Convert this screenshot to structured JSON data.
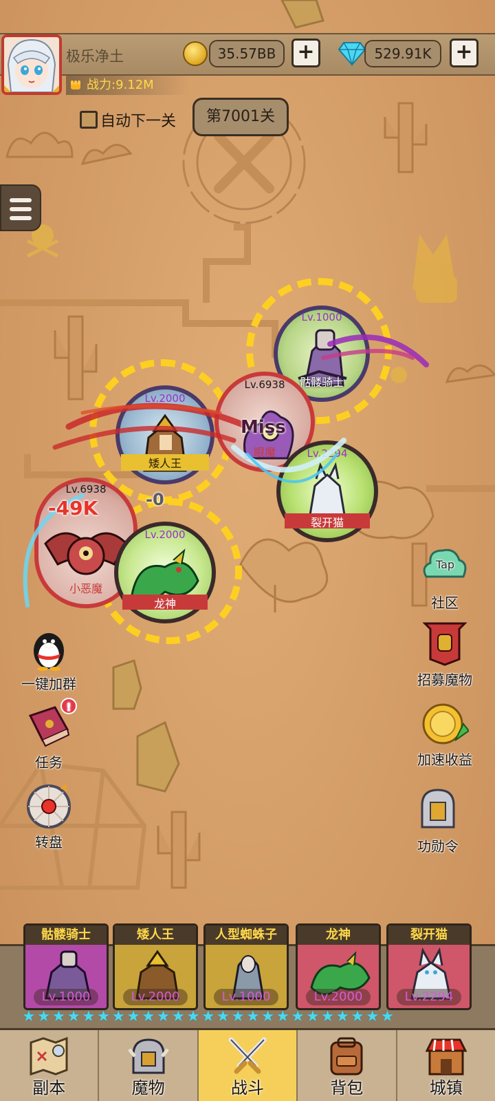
{
  "player": {
    "name": "极乐净土",
    "power": "战力:9.12M"
  },
  "currency": {
    "gold": "35.57BB",
    "gems": "529.91K",
    "plus": "+"
  },
  "stage": {
    "auto_next_label": "自动下一关",
    "level_label": "第7001关"
  },
  "battle_units": [
    {
      "lv": "Lv.1000",
      "name": "骷髅骑士",
      "lv_color": "#9b30c9"
    },
    {
      "lv": "Lv.2000",
      "name": "矮人王",
      "lv_color": "#9b30c9"
    },
    {
      "lv": "Lv.6938",
      "name": "眼魔",
      "lv_color": "#1a1a1a"
    },
    {
      "lv": "Lv.2294",
      "name": "裂开猫",
      "lv_color": "#9b30c9"
    },
    {
      "lv": "Lv.6938",
      "name": "小恶魔",
      "lv_color": "#1a1a1a"
    },
    {
      "lv": "Lv.2000",
      "name": "龙神",
      "lv_color": "#9b30c9"
    }
  ],
  "floating_text": {
    "miss": "Miss",
    "damage": "-49K",
    "zero": "-0"
  },
  "side_buttons": {
    "community": "社区",
    "community_tag": "Tap",
    "recruit": "招募魔物",
    "boost": "加速收益",
    "merit": "功勋令",
    "join_group": "一键加群",
    "tasks": "任务",
    "tasks_badge": "!",
    "wheel": "转盘"
  },
  "roster": [
    {
      "name": "骷髅骑士",
      "lv": "Lv.1000",
      "bg": "#b34aa8"
    },
    {
      "name": "矮人王",
      "lv": "Lv.2000",
      "bg": "#c8a43a"
    },
    {
      "name": "人型蜘蛛子",
      "lv": "Lv.1000",
      "bg": "#c8a43a"
    },
    {
      "name": "龙神",
      "lv": "Lv.2000",
      "bg": "#d0566a"
    },
    {
      "name": "裂开猫",
      "lv": "Lv.2294",
      "bg": "#d0566a"
    }
  ],
  "nav": [
    {
      "label": "副本",
      "icon": "map-icon"
    },
    {
      "label": "魔物",
      "icon": "helmet-icon"
    },
    {
      "label": "战斗",
      "icon": "crossed-swords-icon",
      "active": true
    },
    {
      "label": "背包",
      "icon": "backpack-icon"
    },
    {
      "label": "城镇",
      "icon": "shop-icon"
    }
  ],
  "colors": {
    "accent_yellow": "#ffd21e",
    "gem_cyan": "#4ad8f0",
    "nav_active": "#f5cf5a"
  }
}
